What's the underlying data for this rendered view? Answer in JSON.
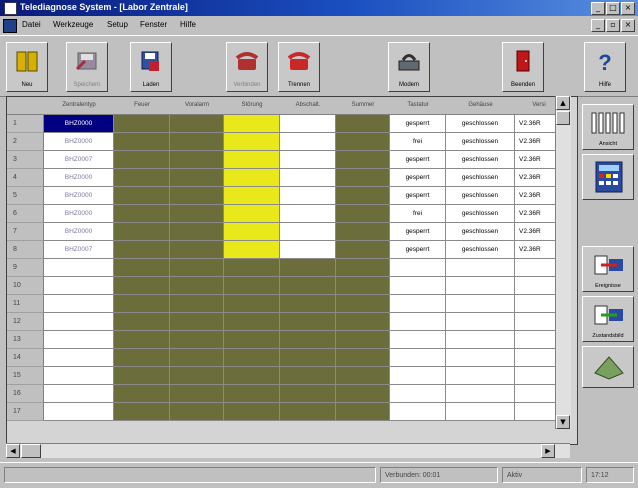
{
  "window": {
    "title": "Telediagnose System - [Labor Zentrale]"
  },
  "menu": [
    "Datei",
    "Werkzeuge",
    "Setup",
    "Fenster",
    "Hilfe"
  ],
  "toolbar": [
    {
      "label": "Neu",
      "icon": "new-icon",
      "enabled": true
    },
    {
      "label": "Speichern",
      "icon": "save-icon",
      "enabled": false
    },
    {
      "label": "Laden",
      "icon": "load-icon",
      "enabled": true
    },
    {
      "label": "Verbinden",
      "icon": "phone-connect-icon",
      "enabled": false
    },
    {
      "label": "Trennen",
      "icon": "phone-hangup-icon",
      "enabled": true
    },
    {
      "label": "Modem",
      "icon": "modem-icon",
      "enabled": true
    },
    {
      "label": "Beenden",
      "icon": "exit-door-icon",
      "enabled": true
    },
    {
      "label": "Hilfe",
      "icon": "help-icon",
      "enabled": true
    }
  ],
  "grid": {
    "headers": [
      "Zentralentyp",
      "Feuer",
      "Voralarm",
      "Störung",
      "Abschalt.",
      "Summer",
      "Tastatur",
      "Gehäuse",
      "Versi"
    ],
    "row_numbers": [
      "1",
      "2",
      "3",
      "4",
      "5",
      "6",
      "7",
      "8",
      "9",
      "10",
      "11",
      "12",
      "13",
      "14",
      "15",
      "16",
      "17"
    ],
    "rows": [
      {
        "typ": "BHZ0000",
        "tastatur": "gesperrt",
        "gehaeuse": "geschlossen",
        "version": "V2.36R",
        "selected": true
      },
      {
        "typ": "BHZ0000",
        "tastatur": "frei",
        "gehaeuse": "geschlossen",
        "version": "V2.36R"
      },
      {
        "typ": "BHZ0007",
        "tastatur": "gesperrt",
        "gehaeuse": "geschlossen",
        "version": "V2.36R"
      },
      {
        "typ": "BHZ0000",
        "tastatur": "gesperrt",
        "gehaeuse": "geschlossen",
        "version": "V2.36R"
      },
      {
        "typ": "BHZ0000",
        "tastatur": "gesperrt",
        "gehaeuse": "geschlossen",
        "version": "V2.36R"
      },
      {
        "typ": "BHZ0000",
        "tastatur": "frei",
        "gehaeuse": "geschlossen",
        "version": "V2.36R"
      },
      {
        "typ": "BHZ0000",
        "tastatur": "gesperrt",
        "gehaeuse": "geschlossen",
        "version": "V2.36R"
      },
      {
        "typ": "BHZ0007",
        "tastatur": "gesperrt",
        "gehaeuse": "geschlossen",
        "version": "V2.36R"
      }
    ]
  },
  "colors": {
    "olive": "#6b6e3a",
    "yellow": "#e8e81a",
    "white": "#ffffff",
    "selected_bg": "#000080"
  },
  "right_panel": [
    {
      "label": "Ansicht",
      "icon": "bar-columns-icon"
    },
    {
      "label": "",
      "icon": "calculator-panel-icon"
    },
    {
      "label": "Ereignisse",
      "icon": "events-icon"
    },
    {
      "label": "Zustandsbild",
      "icon": "status-image-icon"
    },
    {
      "label": "",
      "icon": "floppy-panel-icon"
    }
  ],
  "status": {
    "connection": "Verbunden: 00:01",
    "state": "Aktiv",
    "time": "17:12"
  }
}
